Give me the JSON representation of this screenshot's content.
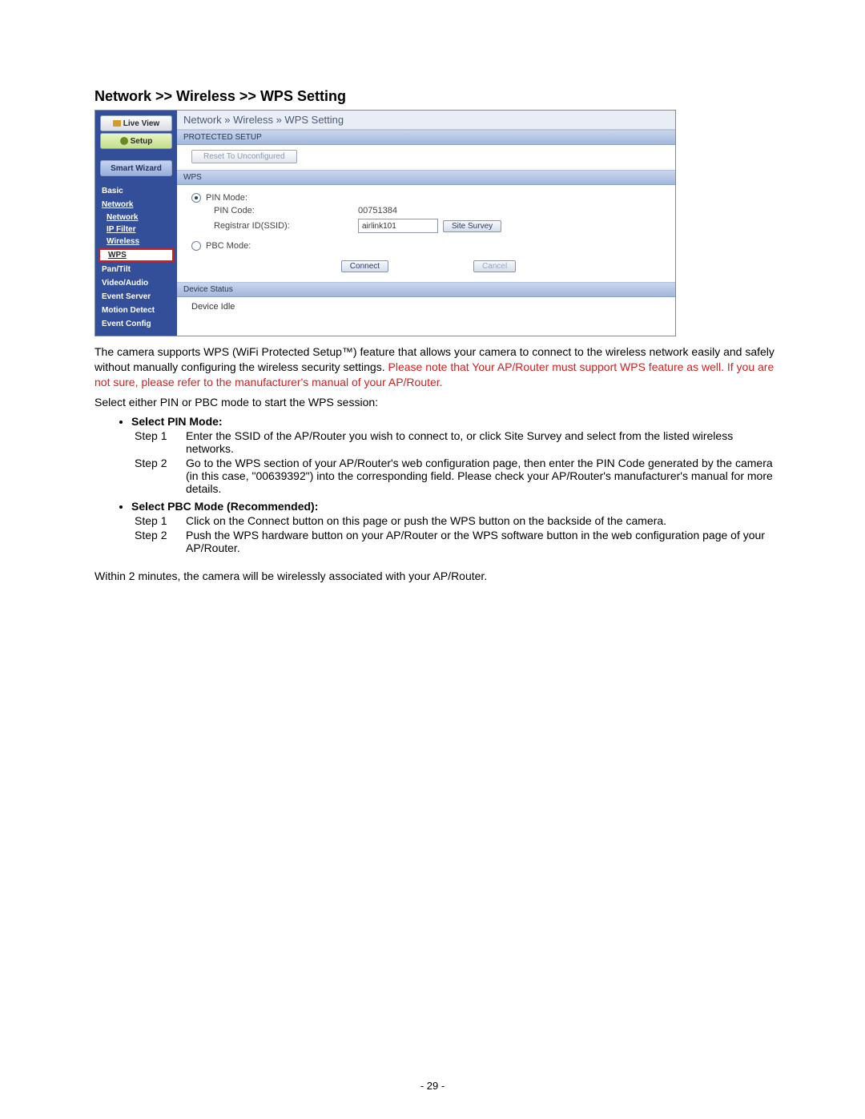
{
  "title": "Network >> Wireless >> WPS Setting",
  "panel": {
    "sidebar": {
      "live_view": "Live View",
      "setup": "Setup",
      "smart_wizard": "Smart Wizard",
      "items": [
        {
          "label": "Basic",
          "type": "section"
        },
        {
          "label": "Network",
          "type": "section-link"
        },
        {
          "label": "Network",
          "type": "item"
        },
        {
          "label": "IP Filter",
          "type": "item"
        },
        {
          "label": "Wireless",
          "type": "item"
        },
        {
          "label": "WPS",
          "type": "active"
        },
        {
          "label": "Pan/Tilt",
          "type": "section"
        },
        {
          "label": "Video/Audio",
          "type": "section"
        },
        {
          "label": "Event Server",
          "type": "section"
        },
        {
          "label": "Motion Detect",
          "type": "section"
        },
        {
          "label": "Event Config",
          "type": "section"
        }
      ]
    },
    "breadcrumb": "Network » Wireless  » WPS Setting",
    "protected_setup_label": "PROTECTED SETUP",
    "reset_btn": "Reset To Unconfigured",
    "wps_label": "WPS",
    "pin_mode_label": "PIN Mode:",
    "pin_code_label": "PIN Code:",
    "pin_code_value": "00751384",
    "registrar_label": "Registrar ID(SSID):",
    "registrar_value": "airlink101",
    "site_survey_btn": "Site Survey",
    "pbc_mode_label": "PBC Mode:",
    "connect_btn": "Connect",
    "cancel_btn": "Cancel",
    "device_status_label": "Device Status",
    "device_status_value": "Device Idle"
  },
  "doc": {
    "p1a": "The camera supports WPS (WiFi Protected Setup™) feature that allows your camera to connect to the wireless network easily and safely without manually configuring the wireless security settings. ",
    "p1b": "Please note that Your AP/Router must support WPS feature as well. If you are not sure, please refer to the manufacturer's manual of your AP/Router.",
    "p2": "Select either PIN or PBC mode to start the WPS session:",
    "pin": {
      "title": "Select PIN Mode:",
      "steps": [
        {
          "n": "Step 1",
          "t": "Enter the SSID of the AP/Router you wish to connect to, or click Site Survey and select from the listed wireless networks."
        },
        {
          "n": "Step 2",
          "t": "Go to the WPS section of your AP/Router's web configuration page, then enter the PIN Code generated by the camera (in this case, \"00639392\") into the corresponding field. Please check your AP/Router's manufacturer's manual for more details."
        }
      ]
    },
    "pbc": {
      "title": "Select PBC Mode (Recommended):",
      "steps": [
        {
          "n": "Step 1",
          "t": "Click on the Connect button on this page or push the WPS button on the backside of the camera."
        },
        {
          "n": "Step 2",
          "t": "Push the WPS hardware button on your AP/Router or the WPS software button in the web configuration page of your AP/Router."
        }
      ]
    },
    "p3": "Within 2 minutes, the camera will be wirelessly associated with your AP/Router.",
    "page_number": "- 29 -"
  }
}
